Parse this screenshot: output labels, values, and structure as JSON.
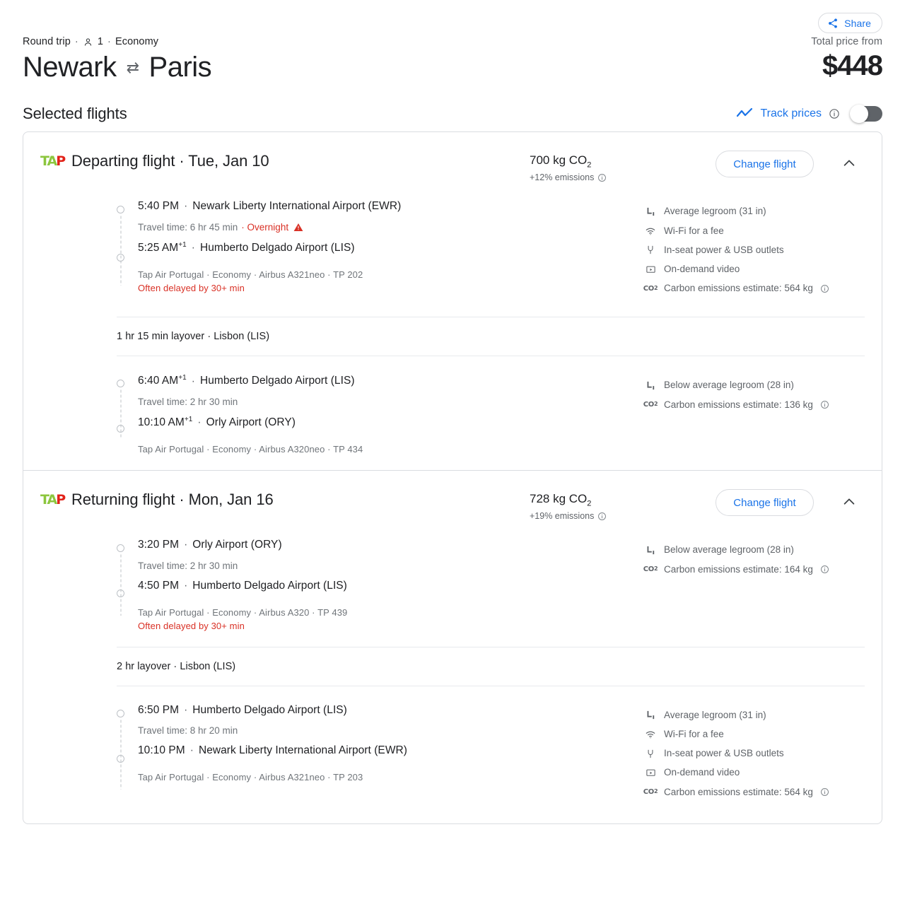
{
  "header": {
    "share_label": "Share",
    "trip_type": "Round trip",
    "passengers": "1",
    "cabin": "Economy",
    "origin": "Newark",
    "destination": "Paris",
    "swap_icon": "⇄",
    "price_label": "Total price from",
    "price_value": "$448"
  },
  "selected": {
    "title": "Selected flights",
    "track_label": "Track prices",
    "toggle_state": "off"
  },
  "accent_colors": {
    "link_blue": "#1a73e8",
    "alert_red": "#d93025",
    "muted_gray": "#5f6368",
    "border_gray": "#dadce0"
  },
  "flights": [
    {
      "airline_logo_green": "TA",
      "airline_logo_red": "P",
      "title": "Departing flight · Tue, Jan 10",
      "co2_total": "700 kg CO",
      "co2_sub": "2",
      "emissions_delta": "+12% emissions",
      "change_button": "Change flight",
      "legs": [
        {
          "depart_time": "5:40 PM",
          "depart_plus": "",
          "depart_airport": "Newark Liberty International Airport (EWR)",
          "travel_time": "Travel time: 6 hr 45 min",
          "overnight": "· Overnight",
          "has_warning": true,
          "arrive_time": "5:25 AM",
          "arrive_plus": "+1",
          "arrive_airport": "Humberto Delgado Airport (LIS)",
          "carrier": "Tap Air Portugal · Economy · Airbus A321neo · TP 202",
          "delay": "Often delayed by 30+ min",
          "amenities": [
            {
              "icon": "legroom-icon",
              "text": "Average legroom (31 in)"
            },
            {
              "icon": "wifi-icon",
              "text": "Wi-Fi for a fee"
            },
            {
              "icon": "power-icon",
              "text": "In-seat power & USB outlets"
            },
            {
              "icon": "video-icon",
              "text": "On-demand video"
            },
            {
              "icon": "co2-icon",
              "text": "Carbon emissions estimate: 564 kg",
              "info": true
            }
          ]
        },
        {
          "depart_time": "6:40 AM",
          "depart_plus": "+1",
          "depart_airport": "Humberto Delgado Airport (LIS)",
          "travel_time": "Travel time: 2 hr 30 min",
          "overnight": "",
          "has_warning": false,
          "arrive_time": "10:10 AM",
          "arrive_plus": "+1",
          "arrive_airport": "Orly Airport (ORY)",
          "carrier": "Tap Air Portugal · Economy · Airbus A320neo · TP 434",
          "delay": "",
          "amenities": [
            {
              "icon": "legroom-icon",
              "text": "Below average legroom (28 in)"
            },
            {
              "icon": "co2-icon",
              "text": "Carbon emissions estimate: 136 kg",
              "info": true
            }
          ]
        }
      ],
      "layover": "1 hr 15 min layover · Lisbon (LIS)"
    },
    {
      "airline_logo_green": "TA",
      "airline_logo_red": "P",
      "title": "Returning flight · Mon, Jan 16",
      "co2_total": "728 kg CO",
      "co2_sub": "2",
      "emissions_delta": "+19% emissions",
      "change_button": "Change flight",
      "legs": [
        {
          "depart_time": "3:20 PM",
          "depart_plus": "",
          "depart_airport": "Orly Airport (ORY)",
          "travel_time": "Travel time: 2 hr 30 min",
          "overnight": "",
          "has_warning": false,
          "arrive_time": "4:50 PM",
          "arrive_plus": "",
          "arrive_airport": "Humberto Delgado Airport (LIS)",
          "carrier": "Tap Air Portugal · Economy · Airbus A320 · TP 439",
          "delay": "Often delayed by 30+ min",
          "amenities": [
            {
              "icon": "legroom-icon",
              "text": "Below average legroom (28 in)"
            },
            {
              "icon": "co2-icon",
              "text": "Carbon emissions estimate: 164 kg",
              "info": true
            }
          ]
        },
        {
          "depart_time": "6:50 PM",
          "depart_plus": "",
          "depart_airport": "Humberto Delgado Airport (LIS)",
          "travel_time": "Travel time: 8 hr 20 min",
          "overnight": "",
          "has_warning": false,
          "arrive_time": "10:10 PM",
          "arrive_plus": "",
          "arrive_airport": "Newark Liberty International Airport (EWR)",
          "carrier": "Tap Air Portugal · Economy · Airbus A321neo · TP 203",
          "delay": "",
          "amenities": [
            {
              "icon": "legroom-icon",
              "text": "Average legroom (31 in)"
            },
            {
              "icon": "wifi-icon",
              "text": "Wi-Fi for a fee"
            },
            {
              "icon": "power-icon",
              "text": "In-seat power & USB outlets"
            },
            {
              "icon": "video-icon",
              "text": "On-demand video"
            },
            {
              "icon": "co2-icon",
              "text": "Carbon emissions estimate: 564 kg",
              "info": true
            }
          ]
        }
      ],
      "layover": "2 hr layover · Lisbon (LIS)"
    }
  ]
}
